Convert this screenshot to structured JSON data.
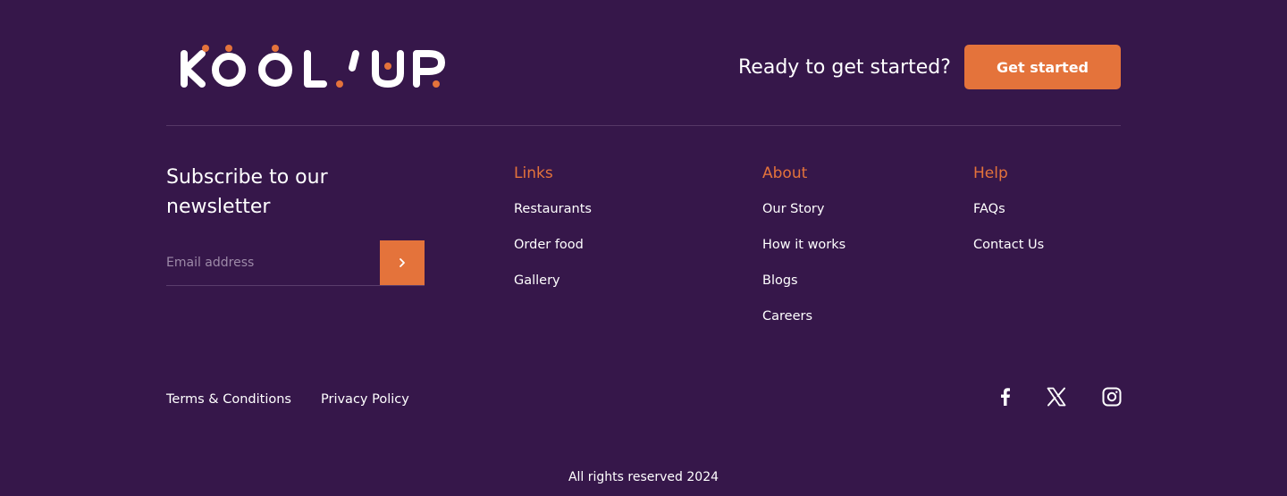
{
  "brand": {
    "logo_text": "KOOL'UP"
  },
  "cta": {
    "text": "Ready to get started?",
    "button_label": "Get started"
  },
  "newsletter": {
    "title": "Subscribe to our newsletter",
    "placeholder": "Email address",
    "submit_icon": "chevron-right-icon"
  },
  "columns": {
    "links": {
      "heading": "Links",
      "items": [
        "Restaurants",
        "Order food",
        "Gallery"
      ]
    },
    "about": {
      "heading": "About",
      "items": [
        "Our Story",
        "How it works",
        "Blogs",
        "Careers"
      ]
    },
    "help": {
      "heading": "Help",
      "items": [
        "FAQs",
        "Contact Us"
      ]
    }
  },
  "legal": {
    "terms": "Terms & Conditions",
    "privacy": "Privacy Policy"
  },
  "social": [
    "facebook-icon",
    "x-twitter-icon",
    "instagram-icon"
  ],
  "copyright": "All rights reserved 2024",
  "colors": {
    "background": "#36174a",
    "accent": "#e4733b",
    "text": "#ffffff"
  }
}
